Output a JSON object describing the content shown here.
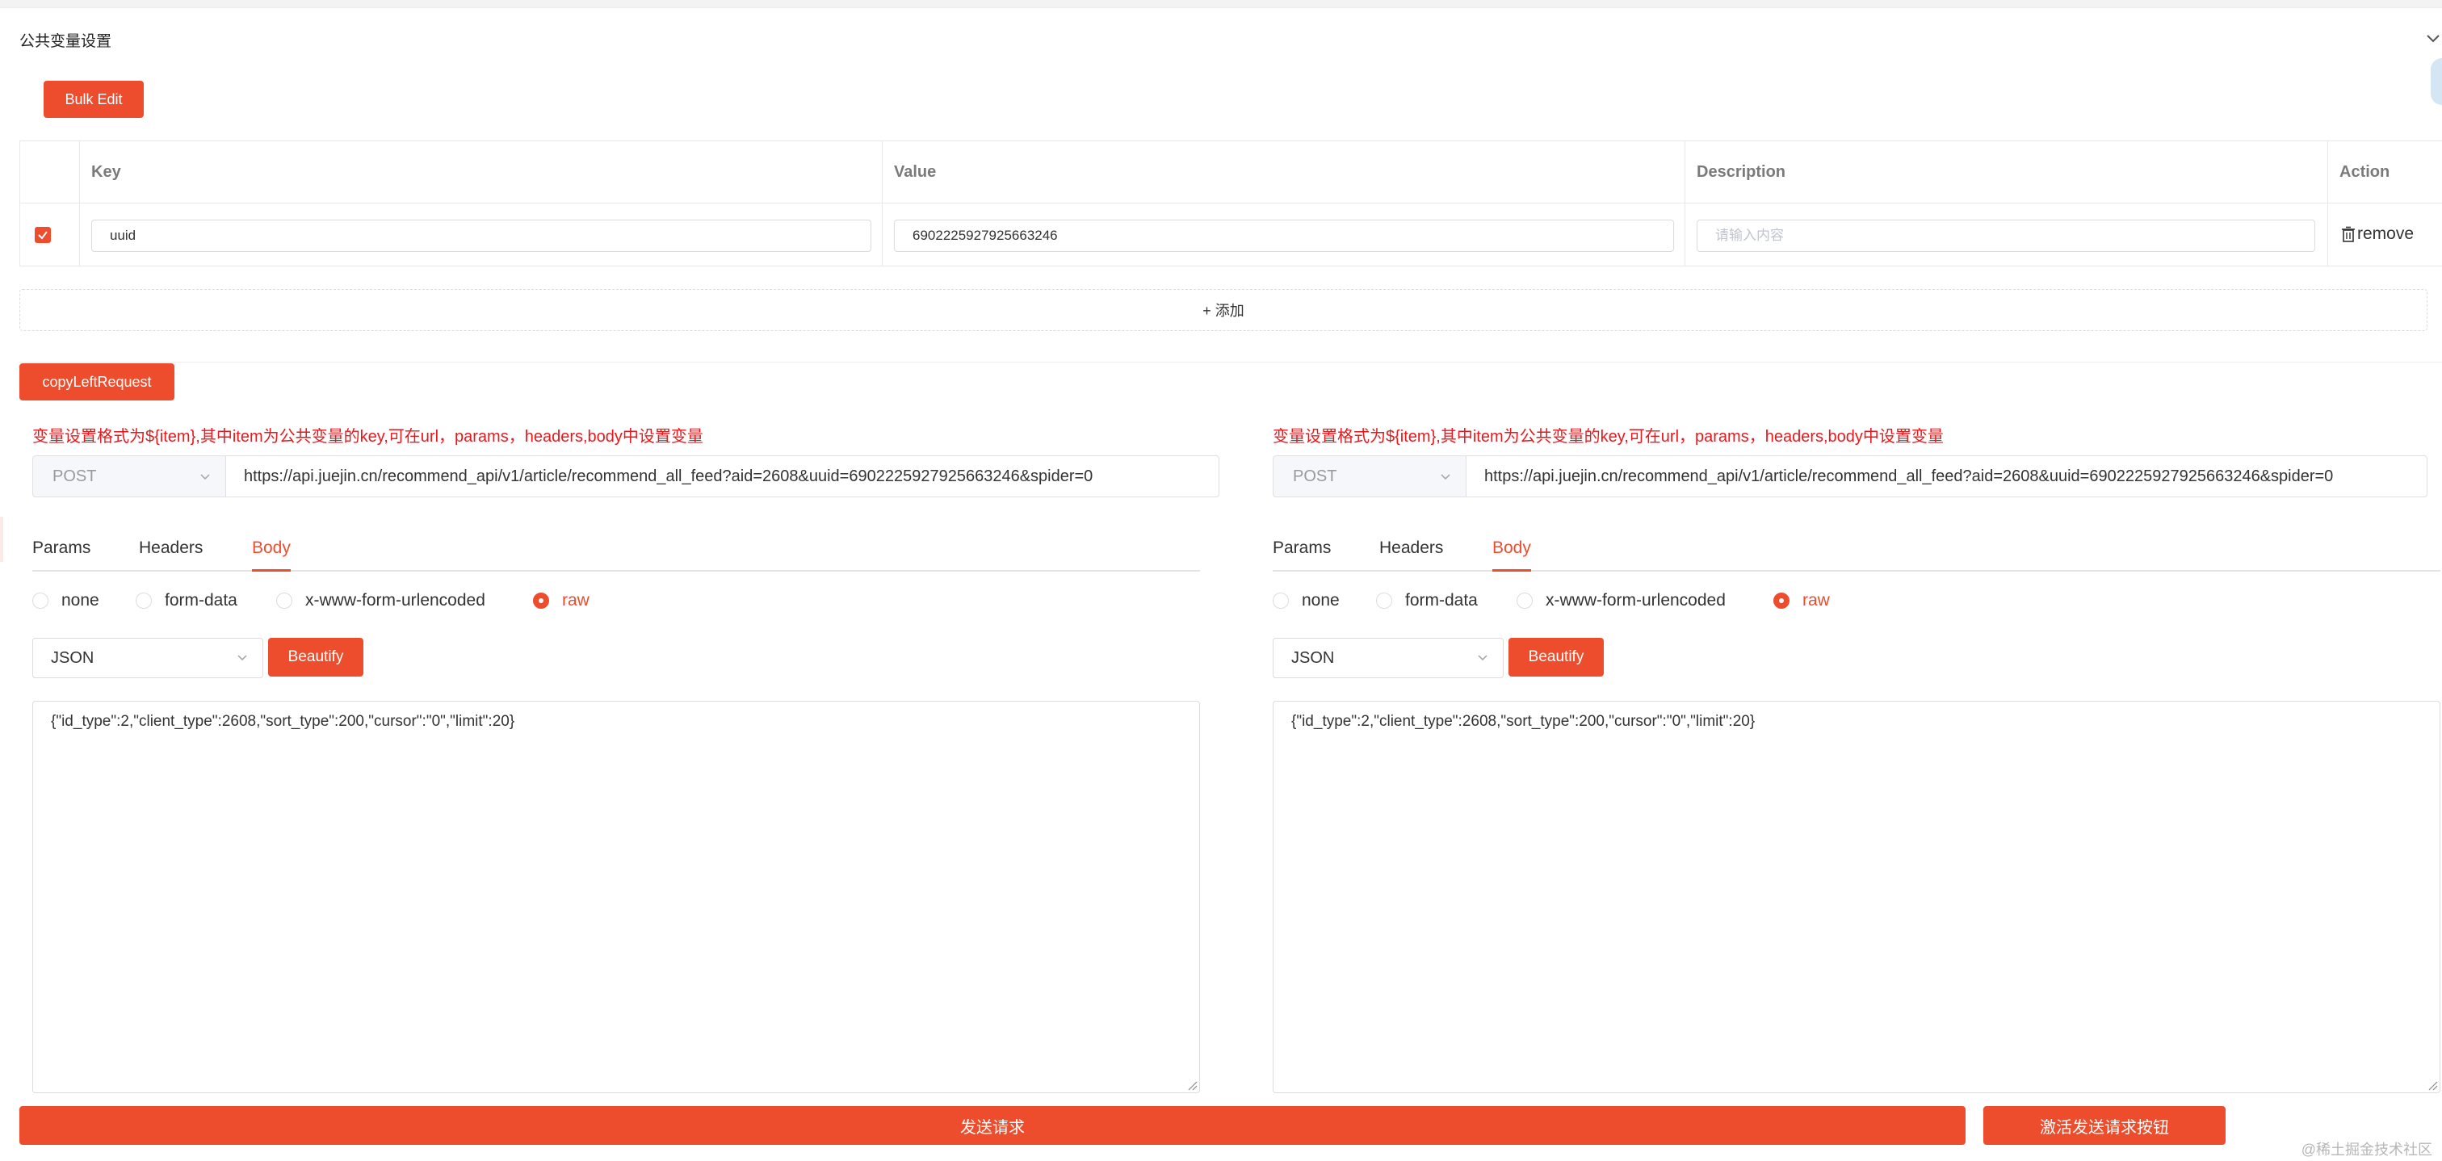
{
  "section": {
    "title": "公共变量设置",
    "bulk_edit_label": "Bulk Edit"
  },
  "variables_table": {
    "columns": [
      "Key",
      "Value",
      "Description",
      "Action"
    ],
    "rows": [
      {
        "checked": true,
        "key": "uuid",
        "value": "6902225927925663246",
        "description_placeholder": "请输入内容",
        "action_label": "remove"
      }
    ],
    "add_label": "+ 添加"
  },
  "copy_left_label": "copyLeftRequest",
  "panels": [
    {
      "hint": "变量设置格式为${item},其中item为公共变量的key,可在url，params，headers,body中设置变量",
      "method": "POST",
      "url": "https://api.juejin.cn/recommend_api/v1/article/recommend_all_feed?aid=2608&uuid=6902225927925663246&spider=0",
      "tabs": [
        "Params",
        "Headers",
        "Body"
      ],
      "active_tab": "Body",
      "body_types": [
        "none",
        "form-data",
        "x-www-form-urlencoded",
        "raw"
      ],
      "selected_body_type": "raw",
      "language": "JSON",
      "beautify_label": "Beautify",
      "body": "{\"id_type\":2,\"client_type\":2608,\"sort_type\":200,\"cursor\":\"0\",\"limit\":20}"
    },
    {
      "hint": "变量设置格式为${item},其中item为公共变量的key,可在url，params，headers,body中设置变量",
      "method": "POST",
      "url": "https://api.juejin.cn/recommend_api/v1/article/recommend_all_feed?aid=2608&uuid=6902225927925663246&spider=0",
      "tabs": [
        "Params",
        "Headers",
        "Body"
      ],
      "active_tab": "Body",
      "body_types": [
        "none",
        "form-data",
        "x-www-form-urlencoded",
        "raw"
      ],
      "selected_body_type": "raw",
      "language": "JSON",
      "beautify_label": "Beautify",
      "body": "{\"id_type\":2,\"client_type\":2608,\"sort_type\":200,\"cursor\":\"0\",\"limit\":20}"
    }
  ],
  "footer": {
    "send_label": "发送请求",
    "activate_label": "激活发送请求按钮"
  },
  "watermark": "@稀土掘金技术社区",
  "colors": {
    "accent": "#ee4d2d",
    "hint_text": "#e8181d"
  },
  "icons": {
    "collapse": "chevron-down-icon",
    "checkbox": "check-icon",
    "remove": "trash-icon",
    "select": "chevron-down-icon",
    "resize": "resize-grip-icon"
  }
}
